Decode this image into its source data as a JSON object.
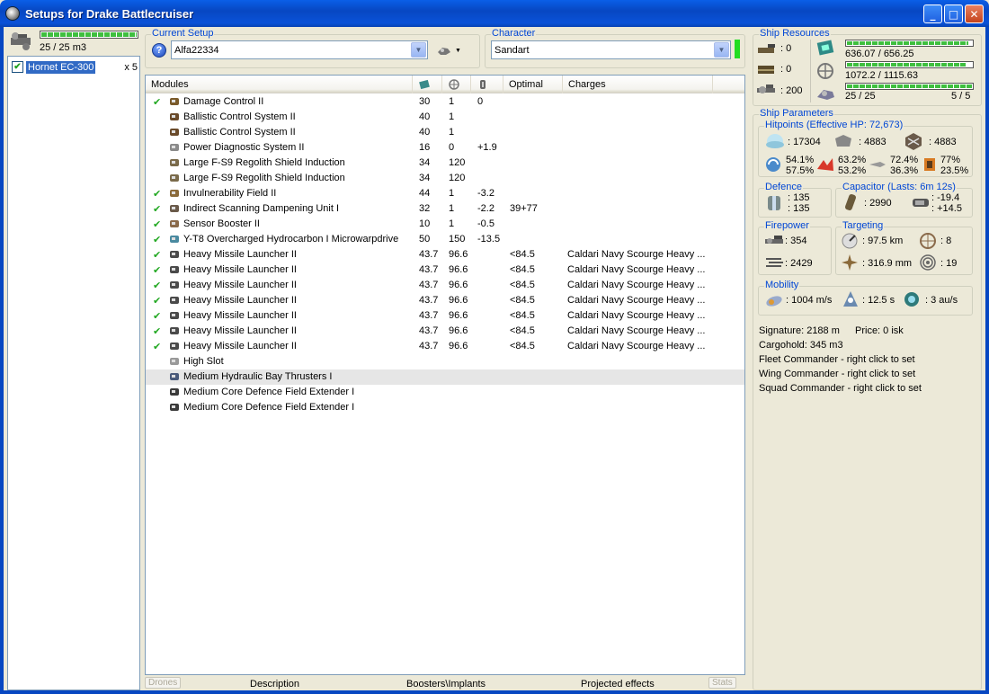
{
  "window": {
    "title": "Setups for Drake Battlecruiser"
  },
  "drones": {
    "capacity": "25 / 25 m3",
    "bar_fraction": 1.0,
    "items": [
      {
        "name": "Hornet EC-300",
        "count": "x 5",
        "checked": true
      }
    ]
  },
  "current_setup": {
    "label": "Current Setup",
    "value": "Alfa22334",
    "help": "?"
  },
  "character": {
    "label": "Character",
    "value": "Sandart",
    "status_color": "#22dd22"
  },
  "modules": {
    "columns": [
      "Modules",
      "",
      "",
      "",
      "Optimal",
      "Charges"
    ],
    "rows": [
      {
        "check": "✔",
        "name": "Damage Control II",
        "cpu": "30",
        "pg": "1",
        "cap": "0",
        "optimal": "",
        "charges": ""
      },
      {
        "check": "",
        "name": "Ballistic Control System II",
        "cpu": "40",
        "pg": "1",
        "cap": "",
        "optimal": "",
        "charges": ""
      },
      {
        "check": "",
        "name": "Ballistic Control System II",
        "cpu": "40",
        "pg": "1",
        "cap": "",
        "optimal": "",
        "charges": ""
      },
      {
        "check": "",
        "name": "Power Diagnostic System II",
        "cpu": "16",
        "pg": "0",
        "cap": "+1.9",
        "optimal": "",
        "charges": ""
      },
      {
        "check": "",
        "name": "Large F-S9 Regolith Shield Induction",
        "cpu": "34",
        "pg": "120",
        "cap": "",
        "optimal": "",
        "charges": ""
      },
      {
        "check": "",
        "name": "Large F-S9 Regolith Shield Induction",
        "cpu": "34",
        "pg": "120",
        "cap": "",
        "optimal": "",
        "charges": ""
      },
      {
        "check": "✔",
        "name": "Invulnerability Field II",
        "cpu": "44",
        "pg": "1",
        "cap": "-3.2",
        "optimal": "",
        "charges": ""
      },
      {
        "check": "✔",
        "name": "Indirect Scanning Dampening Unit I",
        "cpu": "32",
        "pg": "1",
        "cap": "-2.2",
        "optimal": "39+77",
        "charges": ""
      },
      {
        "check": "✔",
        "name": "Sensor Booster II",
        "cpu": "10",
        "pg": "1",
        "cap": "-0.5",
        "optimal": "",
        "charges": ""
      },
      {
        "check": "✔",
        "name": "Y-T8 Overcharged Hydrocarbon I Microwarpdrive",
        "cpu": "50",
        "pg": "150",
        "cap": "-13.5",
        "optimal": "",
        "charges": ""
      },
      {
        "check": "✔",
        "name": "Heavy Missile Launcher II",
        "cpu": "43.7",
        "pg": "96.6",
        "cap": "",
        "optimal": "<84.5",
        "charges": "Caldari Navy Scourge Heavy ..."
      },
      {
        "check": "✔",
        "name": "Heavy Missile Launcher II",
        "cpu": "43.7",
        "pg": "96.6",
        "cap": "",
        "optimal": "<84.5",
        "charges": "Caldari Navy Scourge Heavy ..."
      },
      {
        "check": "✔",
        "name": "Heavy Missile Launcher II",
        "cpu": "43.7",
        "pg": "96.6",
        "cap": "",
        "optimal": "<84.5",
        "charges": "Caldari Navy Scourge Heavy ..."
      },
      {
        "check": "✔",
        "name": "Heavy Missile Launcher II",
        "cpu": "43.7",
        "pg": "96.6",
        "cap": "",
        "optimal": "<84.5",
        "charges": "Caldari Navy Scourge Heavy ..."
      },
      {
        "check": "✔",
        "name": "Heavy Missile Launcher II",
        "cpu": "43.7",
        "pg": "96.6",
        "cap": "",
        "optimal": "<84.5",
        "charges": "Caldari Navy Scourge Heavy ..."
      },
      {
        "check": "✔",
        "name": "Heavy Missile Launcher II",
        "cpu": "43.7",
        "pg": "96.6",
        "cap": "",
        "optimal": "<84.5",
        "charges": "Caldari Navy Scourge Heavy ..."
      },
      {
        "check": "✔",
        "name": "Heavy Missile Launcher II",
        "cpu": "43.7",
        "pg": "96.6",
        "cap": "",
        "optimal": "<84.5",
        "charges": "Caldari Navy Scourge Heavy ..."
      },
      {
        "check": "",
        "name": "High Slot",
        "cpu": "",
        "pg": "",
        "cap": "",
        "optimal": "",
        "charges": ""
      },
      {
        "check": "",
        "name": "Medium Hydraulic Bay Thrusters I",
        "cpu": "",
        "pg": "",
        "cap": "",
        "optimal": "",
        "charges": ""
      },
      {
        "check": "",
        "name": "Medium Core Defence Field Extender I",
        "cpu": "",
        "pg": "",
        "cap": "",
        "optimal": "",
        "charges": ""
      },
      {
        "check": "",
        "name": "Medium Core Defence Field Extender I",
        "cpu": "",
        "pg": "",
        "cap": "",
        "optimal": "",
        "charges": ""
      }
    ]
  },
  "bottom_tabs": {
    "drones": "Drones",
    "description": "Description",
    "boosters": "Boosters\\Implants",
    "projected": "Projected effects",
    "stats": "Stats"
  },
  "ship_resources": {
    "label": "Ship Resources",
    "turrets": ": 0",
    "launchers": ": 0",
    "calibration": ": 200",
    "cpu": "636.07 / 656.25",
    "cpu_fraction": 0.969,
    "powergrid": "1072.2 / 1115.63",
    "powergrid_fraction": 0.961,
    "drone_bandwidth": "25 / 25",
    "drone_fraction": 1.0,
    "drones_active": "5 / 5"
  },
  "ship_parameters": {
    "label": "Ship Parameters",
    "hitpoints": {
      "label": "Hitpoints (Effective HP: 72,673)",
      "shield": ": 17304",
      "armor": ": 4883",
      "structure": ": 4883",
      "em_top": "54.1%",
      "em_bottom": "57.5%",
      "thermal_top": "63.2%",
      "thermal_bottom": "53.2%",
      "kinetic_top": "72.4%",
      "kinetic_bottom": "36.3%",
      "explosive_top": "77%",
      "explosive_bottom": "23.5%"
    },
    "defence": {
      "label": "Defence",
      "top": ": 135",
      "bottom": ": 135"
    },
    "capacitor": {
      "label": "Capacitor (Lasts: 6m 12s)",
      "amount": ": 2990",
      "delta_top": ": -19.4",
      "delta_bottom": ": +14.5"
    },
    "firepower": {
      "label": "Firepower",
      "dps": ": 354",
      "volley": ": 2429"
    },
    "targeting": {
      "label": "Targeting",
      "range": ": 97.5 km",
      "max_targets": ": 8",
      "scan_res": ": 316.9 mm",
      "sensor_strength": ": 19"
    },
    "mobility": {
      "label": "Mobility",
      "speed": ": 1004 m/s",
      "align": ": 12.5 s",
      "warp": ": 3 au/s"
    },
    "signature": "Signature: 2188 m",
    "price": "Price: 0 isk",
    "cargohold": "Cargohold: 345 m3",
    "fleet_cmd": "Fleet Commander - right click to set",
    "wing_cmd": "Wing Commander - right click to set",
    "squad_cmd": "Squad Commander - right click to set"
  }
}
